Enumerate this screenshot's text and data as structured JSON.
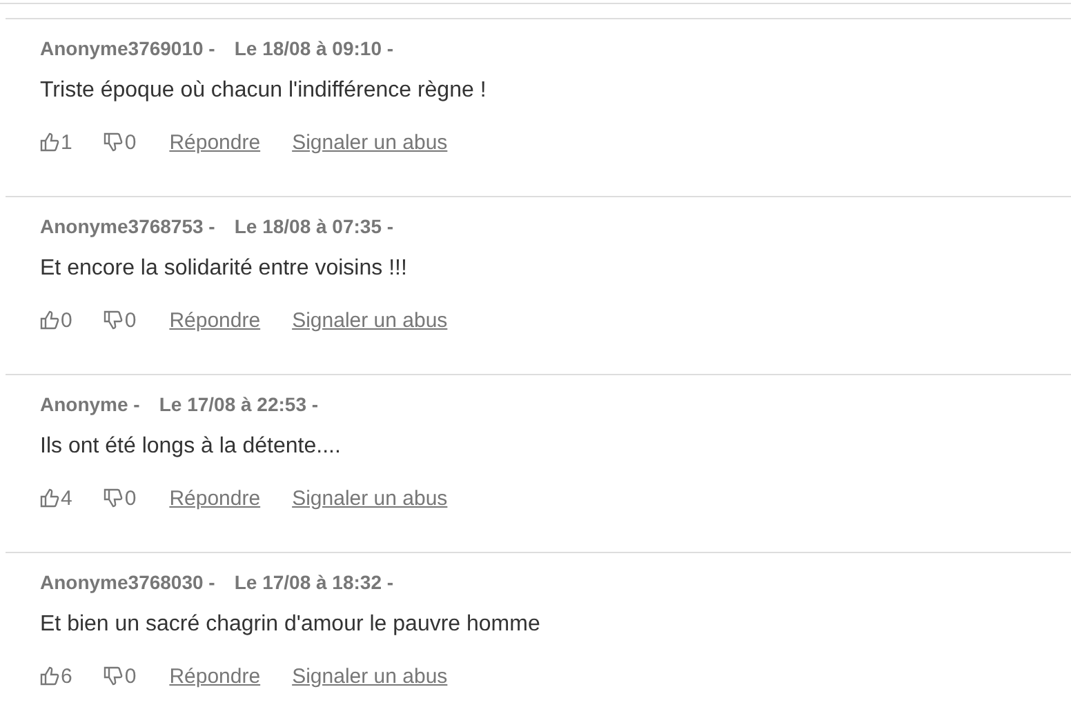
{
  "comments": [
    {
      "author": "Anonyme3769010 -",
      "date": "Le 18/08 à 09:10 -",
      "text": "Triste époque où chacun l'indifférence règne !",
      "likes": "1",
      "dislikes": "0",
      "reply": "Répondre",
      "report": "Signaler un abus"
    },
    {
      "author": "Anonyme3768753 -",
      "date": "Le 18/08 à 07:35 -",
      "text": "Et encore la solidarité entre voisins !!!",
      "likes": "0",
      "dislikes": "0",
      "reply": "Répondre",
      "report": "Signaler un abus"
    },
    {
      "author": "Anonyme -",
      "date": "Le 17/08 à 22:53 -",
      "text": "Ils ont été longs à la détente....",
      "likes": "4",
      "dislikes": "0",
      "reply": "Répondre",
      "report": "Signaler un abus"
    },
    {
      "author": "Anonyme3768030 -",
      "date": "Le 17/08 à 18:32 -",
      "text": "Et bien un sacré chagrin d'amour le pauvre homme",
      "likes": "6",
      "dislikes": "0",
      "reply": "Répondre",
      "report": "Signaler un abus"
    }
  ]
}
